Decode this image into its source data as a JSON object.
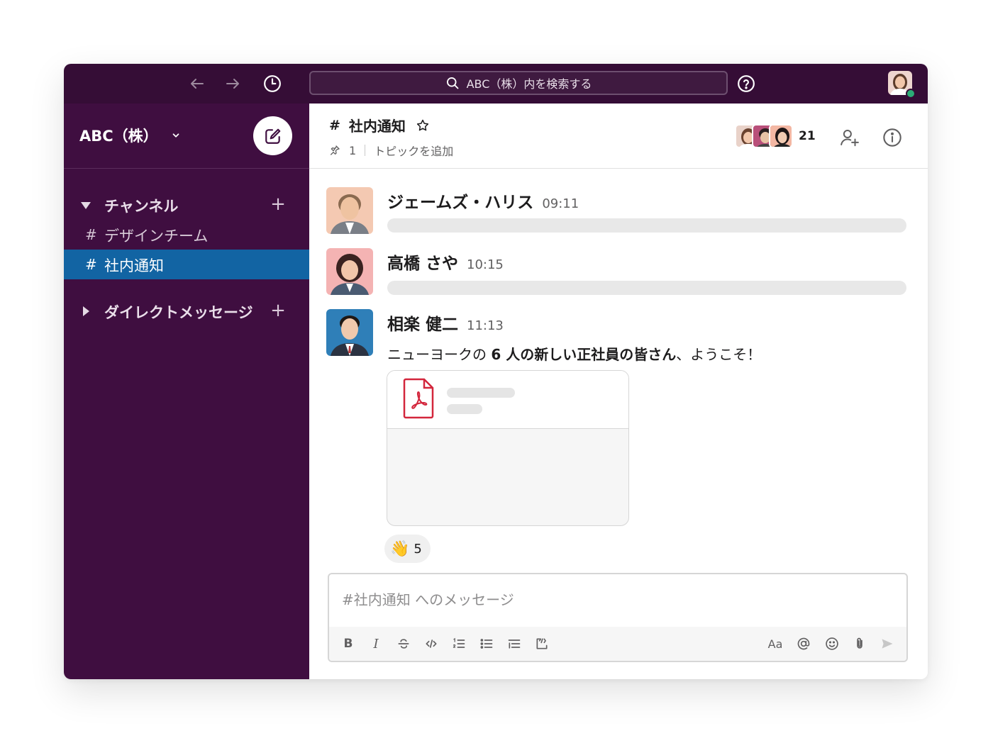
{
  "topbar": {
    "search_text": "ABC（株）内を検索する"
  },
  "sidebar": {
    "workspace_name": "ABC（株）",
    "channels_label": "チャンネル",
    "channels": [
      {
        "name": "デザインチーム",
        "active": false
      },
      {
        "name": "社内通知",
        "active": true
      }
    ],
    "dm_label": "ダイレクトメッセージ",
    "add_symbol": "+",
    "hash_symbol": "#"
  },
  "channel": {
    "hash": "#",
    "name": "社内通知",
    "pin_count": "1",
    "topic_placeholder": "トピックを追加",
    "member_count": "21"
  },
  "messages": [
    {
      "author": "ジェームズ・ハリス",
      "time": "09:11"
    },
    {
      "author": "高橋 さや",
      "time": "10:15"
    },
    {
      "author": "相楽 健二",
      "time": "11:13",
      "text_pre": "ニューヨークの ",
      "text_bold": "6 人の新しい正社員の皆さん",
      "text_post": "、ようこそ！",
      "reaction": {
        "emoji": "👋",
        "count": "5"
      }
    }
  ],
  "composer": {
    "placeholder": "#社内通知 へのメッセージ",
    "bold": "B",
    "italic": "I",
    "text_size": "Aa"
  },
  "colors": {
    "topbar": "#350d36",
    "sidebar": "#3f0e40",
    "active_channel": "#1264a3",
    "presence": "#2bac76",
    "pdf_red": "#d3263c"
  }
}
